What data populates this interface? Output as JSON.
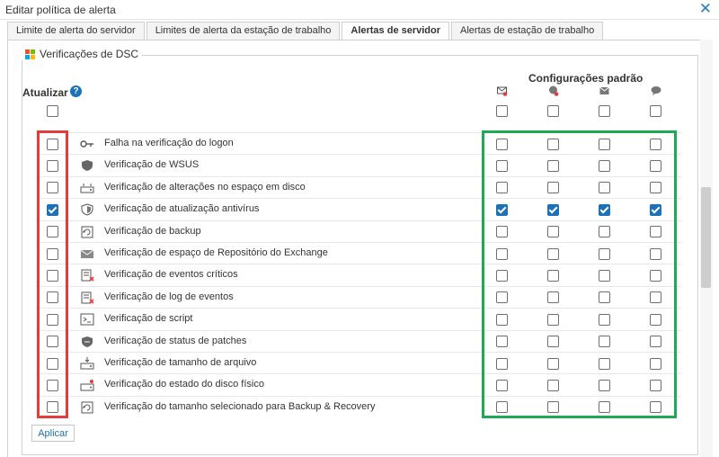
{
  "window": {
    "title": "Editar política de alerta"
  },
  "tabs": [
    {
      "label": "Limite de alerta do servidor",
      "active": false
    },
    {
      "label": "Limites de alerta da estação de trabalho",
      "active": false
    },
    {
      "label": "Alertas de servidor",
      "active": true
    },
    {
      "label": "Alertas de estação de trabalho",
      "active": false
    }
  ],
  "section": {
    "title": "Verificações de DSC"
  },
  "update": {
    "label": "Atualizar",
    "help_icon": "?"
  },
  "defaults": {
    "title": "Configurações padrão"
  },
  "colors": {
    "accent": "#1d71b8",
    "red_highlight": "#e53b3b",
    "green_highlight": "#1fa954"
  },
  "rows": [
    {
      "label": "Falha na verificação do logon",
      "icon": "key-icon",
      "checked": false
    },
    {
      "label": "Verificação de WSUS",
      "icon": "shield-icon",
      "checked": false
    },
    {
      "label": "Verificação de alterações no espaço em disco",
      "icon": "disk-icon",
      "checked": false
    },
    {
      "label": "Verificação de atualização antivírus",
      "icon": "antivirus-shield-icon",
      "checked": true
    },
    {
      "label": "Verificação de backup",
      "icon": "backup-icon",
      "checked": false
    },
    {
      "label": "Verificação de espaço de Repositório do Exchange",
      "icon": "envelope-icon",
      "checked": false
    },
    {
      "label": "Verificação de eventos críticos",
      "icon": "event-log-error-icon",
      "checked": false
    },
    {
      "label": "Verificação de log de eventos",
      "icon": "event-log-icon",
      "checked": false
    },
    {
      "label": "Verificação de script",
      "icon": "script-console-icon",
      "checked": false
    },
    {
      "label": "Verificação de status de patches",
      "icon": "patch-shield-icon",
      "checked": false
    },
    {
      "label": "Verificação de tamanho de arquivo",
      "icon": "file-size-disk-icon",
      "checked": false
    },
    {
      "label": "Verificação do estado do disco físico",
      "icon": "physical-disk-icon",
      "checked": false
    },
    {
      "label": "Verificação do tamanho selecionado para Backup & Recovery",
      "icon": "backup-recovery-icon",
      "checked": false
    }
  ],
  "buttons": {
    "apply": "Aplicar"
  }
}
